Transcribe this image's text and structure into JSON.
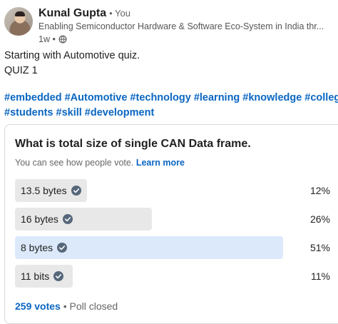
{
  "post": {
    "author": "Kunal Gupta",
    "you_badge": "• You",
    "headline": "Enabling Semiconductor Hardware & Software Eco-System in India thr...",
    "time": "1w •",
    "visibility_icon": "globe-icon",
    "text_lines": [
      "Starting with Automotive quiz.",
      "QUIZ 1"
    ],
    "hashtags": [
      "#embedded",
      "#Automotive",
      "#technology",
      "#learning",
      "#knowledge",
      "#college",
      "#students",
      "#skill",
      "#development"
    ]
  },
  "poll": {
    "question": "What is total size of single CAN Data frame.",
    "vote_note": "You can see how people vote.",
    "learn_more": "Learn more",
    "options": [
      {
        "label": "13.5 bytes",
        "percent_text": "12%",
        "percent": 12,
        "selected": false
      },
      {
        "label": "16 bytes",
        "percent_text": "26%",
        "percent": 26,
        "selected": false
      },
      {
        "label": "8 bytes",
        "percent_text": "51%",
        "percent": 51,
        "selected": true
      },
      {
        "label": "11 bits",
        "percent_text": "11%",
        "percent": 11,
        "selected": false
      }
    ],
    "votes": "259 votes",
    "status": "• Poll closed"
  },
  "colors": {
    "link": "#0a66c2",
    "bar_default": "#e8e8e8",
    "bar_selected": "#dbe9fb",
    "check_icon": "#56687a"
  }
}
